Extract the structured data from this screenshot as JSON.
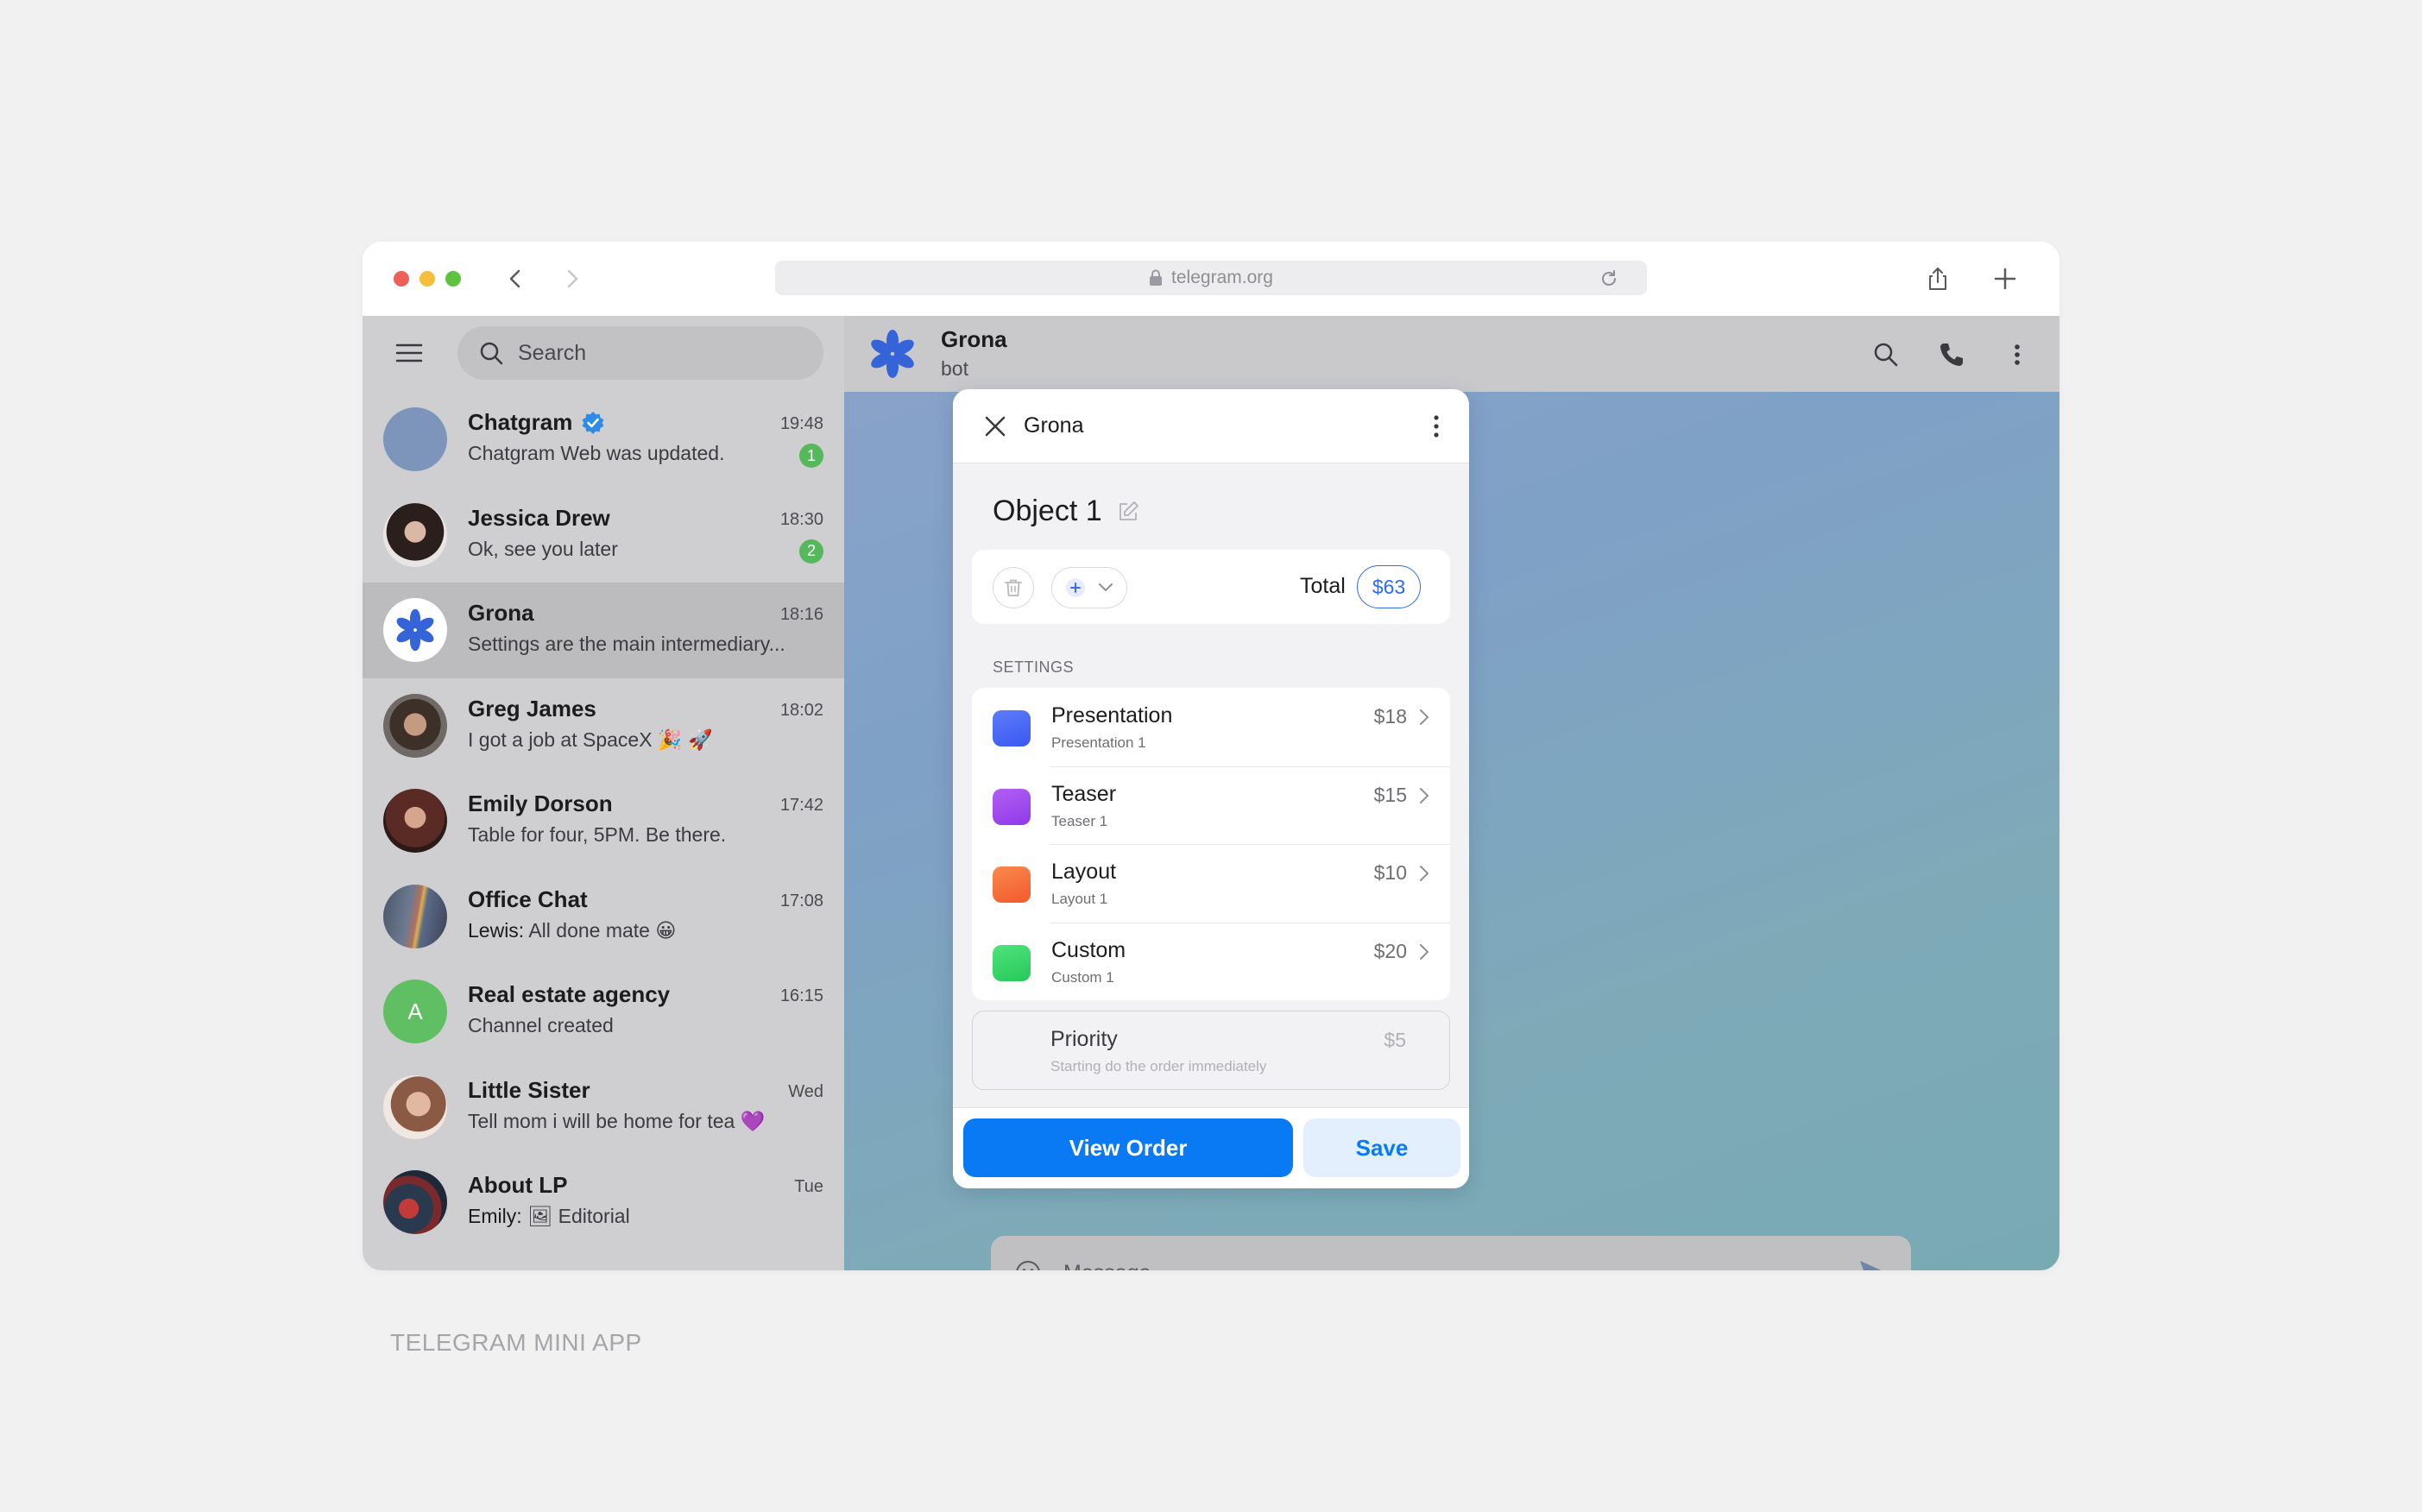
{
  "browser": {
    "url": "telegram.org"
  },
  "sidebar": {
    "search_placeholder": "Search",
    "chats": [
      {
        "name": "Chatgram",
        "verified": true,
        "time": "19:48",
        "preview": "Chatgram Web was updated.",
        "unread": "1",
        "avatar": "plain-blue"
      },
      {
        "name": "Jessica Drew",
        "time": "18:30",
        "preview": "Ok, see you later",
        "unread": "2",
        "avatar": "photo"
      },
      {
        "name": "Grona",
        "time": "18:16",
        "preview": "Settings are the main intermediary...",
        "active": true,
        "avatar": "asterisk-logo"
      },
      {
        "name": "Greg James",
        "time": "18:02",
        "preview": "I got a job at SpaceX 🎉 🚀",
        "avatar": "photo"
      },
      {
        "name": "Emily Dorson",
        "time": "17:42",
        "preview": "Table for four, 5PM. Be there.",
        "avatar": "photo"
      },
      {
        "name": "Office Chat",
        "time": "17:08",
        "sender": "Lewis:",
        "preview": " All done mate 😀",
        "avatar": "photo"
      },
      {
        "name": "Real estate agency",
        "time": "16:15",
        "preview": "Channel created",
        "avatar_letter": "A"
      },
      {
        "name": "Little Sister",
        "time": "Wed",
        "preview": "Tell mom i will be home for tea 💜",
        "avatar": "photo"
      },
      {
        "name": "About LP",
        "time": "Tue",
        "sender": "Emily:",
        "preview": " 🖼 Editorial",
        "avatar": "photo"
      }
    ]
  },
  "chat": {
    "title": "Grona",
    "subtitle": "bot",
    "composer_placeholder": "Message"
  },
  "miniapp": {
    "title": "Grona",
    "object_title": "Object 1",
    "total_label": "Total",
    "total_value": "$63",
    "settings_label": "SETTINGS",
    "settings": [
      {
        "name": "Presentation",
        "sub": "Presentation 1",
        "price": "$18",
        "color": "#4a6cf7"
      },
      {
        "name": "Teaser",
        "sub": "Teaser 1",
        "price": "$15",
        "color": "#a24cf0"
      },
      {
        "name": "Layout",
        "sub": "Layout 1",
        "price": "$10",
        "color": "#f7703a"
      },
      {
        "name": "Custom",
        "sub": "Custom 1",
        "price": "$20",
        "color": "#3bd66c"
      }
    ],
    "priority": {
      "name": "Priority",
      "sub": "Starting do the order immediately",
      "price": "$5"
    },
    "view_order_label": "View Order",
    "save_label": "Save"
  },
  "caption": "TELEGRAM MINI APP",
  "colors": {
    "accent": "#0a7af4",
    "verified": "#2f8be6",
    "unread_badge": "#55b85a",
    "grona_logo": "#3563d8"
  }
}
